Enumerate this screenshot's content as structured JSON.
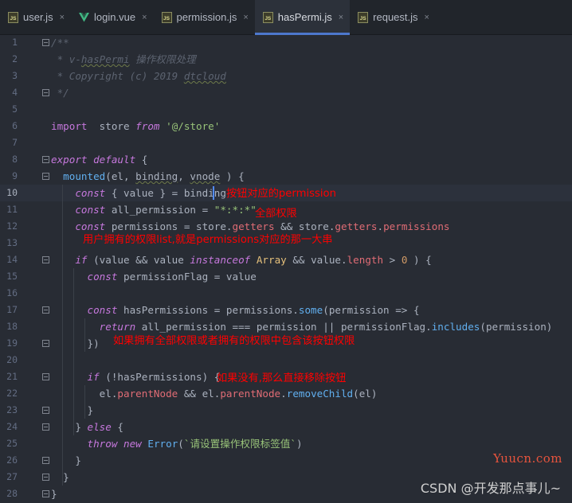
{
  "tabs": [
    {
      "label": "user.js",
      "icon": "js-icon",
      "active": false
    },
    {
      "label": "login.vue",
      "icon": "vue-icon",
      "active": false
    },
    {
      "label": "permission.js",
      "icon": "js-icon",
      "active": false
    },
    {
      "label": "hasPermi.js",
      "icon": "js-icon",
      "active": true
    },
    {
      "label": "request.js",
      "icon": "js-icon",
      "active": false
    }
  ],
  "tab_close_glyph": "×",
  "js_icon_text": "JS",
  "colors": {
    "background": "#282c34",
    "keyword": "#c678dd",
    "comment": "#5c6370",
    "string": "#98c379",
    "function": "#61afef",
    "property": "#e06c75",
    "number": "#d19a66",
    "class": "#e5c07b",
    "annotation": "#ff0000",
    "active_tab_accent": "#4d78cc"
  },
  "current_line": 10,
  "code_lines": [
    {
      "n": 1,
      "segs": [
        [
          "cm",
          "/**"
        ]
      ]
    },
    {
      "n": 2,
      "segs": [
        [
          "cm",
          " * v-"
        ],
        [
          "cm sq",
          "hasPermi"
        ],
        [
          "cm",
          " 操作权限处理"
        ]
      ]
    },
    {
      "n": 3,
      "segs": [
        [
          "cm",
          " * Copyright (c) 2019 "
        ],
        [
          "cm sq",
          "dtcloud"
        ]
      ]
    },
    {
      "n": 4,
      "segs": [
        [
          "cm",
          " */"
        ]
      ]
    },
    {
      "n": 5,
      "segs": []
    },
    {
      "n": 6,
      "segs": [
        [
          "kw",
          "import"
        ],
        [
          "",
          "  store "
        ],
        [
          "kwi",
          "from"
        ],
        [
          "",
          " "
        ],
        [
          "str",
          "'@/store'"
        ]
      ]
    },
    {
      "n": 7,
      "segs": []
    },
    {
      "n": 8,
      "segs": [
        [
          "kwi",
          "export"
        ],
        [
          "",
          " "
        ],
        [
          "kwi",
          "default"
        ],
        [
          "",
          " {"
        ]
      ]
    },
    {
      "n": 9,
      "segs": [
        [
          "",
          "  "
        ],
        [
          "fn",
          "mounted"
        ],
        [
          "",
          "(el, "
        ],
        [
          "sq",
          "binding"
        ],
        [
          "",
          ", "
        ],
        [
          "sq",
          "vnode"
        ],
        [
          "",
          " ) {"
        ]
      ]
    },
    {
      "n": 10,
      "segs": [
        [
          "",
          "    "
        ],
        [
          "kwi",
          "const"
        ],
        [
          "",
          " { value } = binding"
        ]
      ]
    },
    {
      "n": 11,
      "segs": [
        [
          "",
          "    "
        ],
        [
          "kwi",
          "const"
        ],
        [
          "",
          " all_permission = "
        ],
        [
          "str",
          "\"*:*:*\""
        ],
        [
          ";"
        ]
      ]
    },
    {
      "n": 12,
      "segs": [
        [
          "",
          "    "
        ],
        [
          "kwi",
          "const"
        ],
        [
          "",
          " permissions = store."
        ],
        [
          "prop",
          "getters"
        ],
        [
          "",
          " && store."
        ],
        [
          "prop",
          "getters"
        ],
        [
          "",
          "."
        ],
        [
          "prop",
          "permissions"
        ]
      ]
    },
    {
      "n": 13,
      "segs": []
    },
    {
      "n": 14,
      "segs": [
        [
          "",
          "    "
        ],
        [
          "kwi",
          "if"
        ],
        [
          "",
          " (value && value "
        ],
        [
          "kwi",
          "instanceof"
        ],
        [
          "",
          " "
        ],
        [
          "cls",
          "Array"
        ],
        [
          "",
          " && value."
        ],
        [
          "prop",
          "length"
        ],
        [
          "",
          " > "
        ],
        [
          "num",
          "0"
        ],
        [
          "",
          " ) {"
        ]
      ]
    },
    {
      "n": 15,
      "segs": [
        [
          "",
          "      "
        ],
        [
          "kwi",
          "const"
        ],
        [
          "",
          " permissionFlag = value"
        ]
      ]
    },
    {
      "n": 16,
      "segs": []
    },
    {
      "n": 17,
      "segs": [
        [
          "",
          "      "
        ],
        [
          "kwi",
          "const"
        ],
        [
          "",
          " hasPermissions = permissions."
        ],
        [
          "fn",
          "some"
        ],
        [
          "",
          "(permission => {"
        ]
      ]
    },
    {
      "n": 18,
      "segs": [
        [
          "",
          "        "
        ],
        [
          "kwi",
          "return"
        ],
        [
          "",
          " all_permission === permission || permissionFlag."
        ],
        [
          "fn",
          "includes"
        ],
        [
          "",
          "(permission)"
        ]
      ]
    },
    {
      "n": 19,
      "segs": [
        [
          "",
          "      })"
        ]
      ]
    },
    {
      "n": 20,
      "segs": []
    },
    {
      "n": 21,
      "segs": [
        [
          "",
          "      "
        ],
        [
          "kwi",
          "if"
        ],
        [
          "",
          " (!hasPermissions) {"
        ]
      ]
    },
    {
      "n": 22,
      "segs": [
        [
          "",
          "        el."
        ],
        [
          "prop",
          "parentNode"
        ],
        [
          "",
          " && el."
        ],
        [
          "prop",
          "parentNode"
        ],
        [
          "",
          "."
        ],
        [
          "fn",
          "removeChild"
        ],
        [
          "",
          "(el)"
        ]
      ]
    },
    {
      "n": 23,
      "segs": [
        [
          "",
          "      }"
        ]
      ]
    },
    {
      "n": 24,
      "segs": [
        [
          "",
          "    } "
        ],
        [
          "kwi",
          "else"
        ],
        [
          "",
          " {"
        ]
      ]
    },
    {
      "n": 25,
      "segs": [
        [
          "",
          "      "
        ],
        [
          "kwi",
          "throw"
        ],
        [
          "",
          " "
        ],
        [
          "kwi",
          "new"
        ],
        [
          "",
          " "
        ],
        [
          "fn",
          "Error"
        ],
        [
          "",
          "("
        ],
        [
          "str",
          "`请设置操作权限标签值`"
        ],
        [
          "",
          ")"
        ]
      ]
    },
    {
      "n": 26,
      "segs": [
        [
          "",
          "    }"
        ]
      ]
    },
    {
      "n": 27,
      "segs": [
        [
          "",
          "  }"
        ]
      ]
    },
    {
      "n": 28,
      "segs": [
        [
          "",
          "}"
        ]
      ]
    }
  ],
  "annotations": {
    "a1": "按钮对应的permission",
    "a2": "全部权限",
    "a3": "用户拥有的权限list,就是permissions对应的那一大串",
    "a4": "如果拥有全部权限或者拥有的权限中包含该按钮权限",
    "a5": "如果没有,那么直接移除按钮"
  },
  "watermarks": {
    "yuucn": "Yuucn.com",
    "csdn": "CSDN @开发那点事儿~"
  }
}
